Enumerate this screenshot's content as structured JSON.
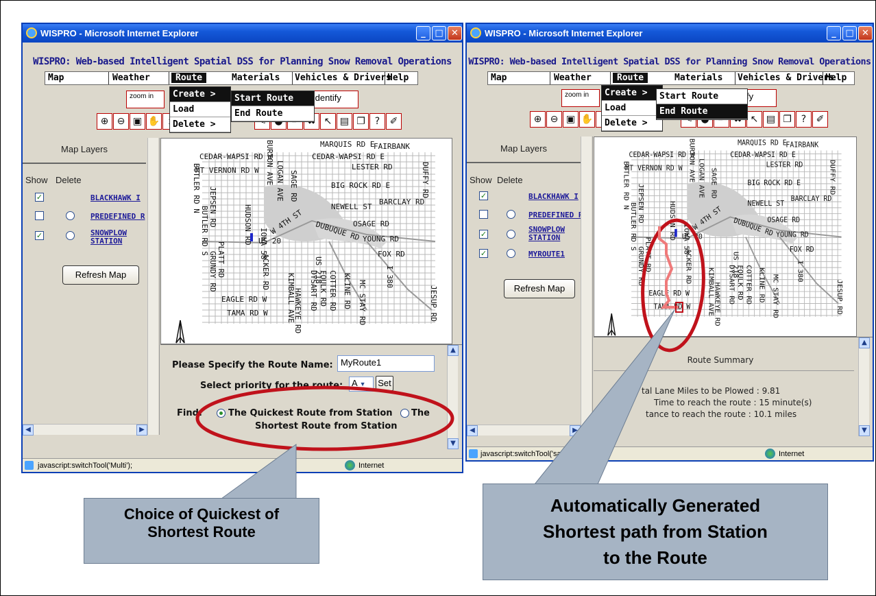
{
  "windows": [
    {
      "title": "WISPRO - Microsoft Internet Explorer",
      "app_title": "WISPRO: Web-based Intelligent Spatial DSS for Planning Snow Removal Operations",
      "menu": [
        "Map",
        "Weather",
        "Route",
        "Materials",
        "Vehicles & Drivers",
        "Help"
      ],
      "zoom_in_label": "zoom in",
      "identify_label": "Identify",
      "route_menu": [
        "Create >",
        "Load",
        "Delete >"
      ],
      "create_submenu": [
        "Start Route",
        "End Route"
      ],
      "highlighted_submenu": "Start Route",
      "map_layers_title": "Map Layers",
      "show_label": "Show",
      "delete_label": "Delete",
      "layers": [
        {
          "name": "BLACKHAWK I",
          "show": true
        },
        {
          "name": "PREDEFINED R",
          "show": false
        },
        {
          "name": "SNOWPLOW STATION",
          "show": true
        }
      ],
      "refresh_label": "Refresh Map",
      "form": {
        "route_name_label": "Please Specify the Route Name:",
        "route_name_value": "MyRoute1",
        "priority_label": "Select priority for the route:",
        "priority_value": "A",
        "set_label": "Set",
        "find_label": "Find:",
        "option_quickest": "The Quickest Route from Station",
        "option_shortest_a": "The",
        "option_shortest_b": "Shortest Route from Station"
      },
      "status": "javascript:switchTool('Multi');",
      "zone": "Internet"
    },
    {
      "title": "WISPRO - Microsoft Internet Explorer",
      "app_title": "WISPRO: Web-based Intelligent Spatial DSS for Planning Snow Removal Operations",
      "menu": [
        "Map",
        "Weather",
        "Route",
        "Materials",
        "Vehicles & Drivers",
        "Help"
      ],
      "zoom_in_label": "zoom in",
      "identify_label": "entify",
      "route_menu": [
        "Create >",
        "Load",
        "Delete >"
      ],
      "create_submenu": [
        "Start Route",
        "End Route"
      ],
      "highlighted_submenu": "End Route",
      "map_layers_title": "Map Layers",
      "show_label": "Show",
      "delete_label": "Delete",
      "layers": [
        {
          "name": "BLACKHAWK I",
          "show": true
        },
        {
          "name": "PREDEFINED R",
          "show": false
        },
        {
          "name": "SNOWPLOW STATION",
          "show": true
        },
        {
          "name": "MYROUTE1",
          "show": true
        }
      ],
      "refresh_label": "Refresh Map",
      "summary": {
        "title": "Route Summary",
        "line1": "tal Lane Miles to be Plowed : 9.81",
        "line2": "Time to reach the route : 15 minute(s)",
        "line3": "tance to reach the route : 10.1 miles"
      },
      "status": "javascript:switchTool('saveR",
      "zone": "Internet"
    }
  ],
  "map_labels": {
    "top": [
      "MARQUIS RD E",
      "FAIRBANK",
      "CEDAR-WAPSI RD W",
      "CEDAR-WAPSI RD E",
      "LESTER RD",
      "MT VERNON RD W",
      "BIG ROCK RD E",
      "NEWELL ST",
      "BARCLAY RD",
      "OSAGE RD",
      "DUBUQUE RD",
      "YOUNG RD",
      "US 20",
      "W 4TH ST",
      "FOX RD",
      "EAGLE RD W",
      "TAMA RD W"
    ],
    "vertical": [
      "BUTLER RD N",
      "JEPSEN RD",
      "HUDSON RD",
      "IOWA 58",
      "BURTON AVE",
      "LOGAN AVE",
      "SAGE RD",
      "DUFFY RD",
      "BUTLER RD S",
      "PLATT RD",
      "GRUNDY RD",
      "ACKER RD",
      "KIMBALL AVE",
      "HAWKEYE RD",
      "DYSART RD",
      "FOULK RD",
      "COTTER RD",
      "KLINE RD",
      "MC STAY RD",
      "JESUP RD",
      "US 218",
      "I 380"
    ]
  },
  "callouts": {
    "left": [
      "Choice of Quickest of",
      "Shortest Route"
    ],
    "right": [
      "Automatically Generated",
      "Shortest path from Station",
      "to the Route"
    ]
  },
  "colors": {
    "highlight_ellipse": "#c0121b",
    "callout_fill": "#a6b4c4",
    "app_title": "#1a1a8c",
    "route_line": "#ef7a7a"
  }
}
